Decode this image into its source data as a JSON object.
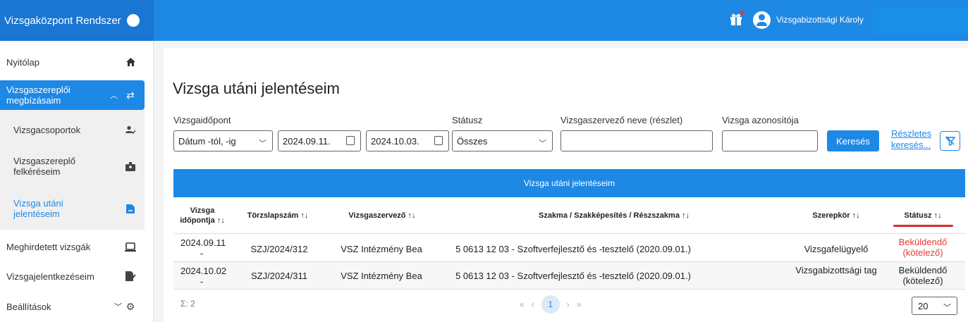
{
  "app": {
    "title": "Vizsgaközpont Rendszer",
    "user": "Vizsgabizottsági Károly"
  },
  "sidebar": {
    "items": [
      {
        "label": "Nyitólap",
        "icon": "home-icon"
      },
      {
        "label": "Vizsgaszereplői megbízásaim",
        "icon": "assignment-icon"
      },
      {
        "label": "Vizsgacsoportok",
        "icon": "group-icon"
      },
      {
        "label": "Vizsgaszereplő felkéréseim",
        "icon": "badge-icon"
      },
      {
        "label": "Vizsga utáni jelentéseim",
        "icon": "document-icon"
      },
      {
        "label": "Meghirdetett vizsgák",
        "icon": "laptop-icon"
      },
      {
        "label": "Vizsgajelentkezéseim",
        "icon": "edit-doc-icon"
      },
      {
        "label": "Beállítások",
        "icon": "gear-icon"
      }
    ]
  },
  "page": {
    "title": "Vizsga utáni jelentéseim"
  },
  "filters": {
    "date_label": "Vizsgaidőpont",
    "date_mode": "Dátum -tól, -ig",
    "date_from": "2024.09.11.",
    "date_to": "2024.10.03.",
    "status_label": "Státusz",
    "status_value": "Összes",
    "organizer_label": "Vizsgaszervező neve (részlet)",
    "organizer_value": "",
    "exam_id_label": "Vizsga azonosítója",
    "exam_id_value": "",
    "search_button": "Keresés",
    "advanced_link": "Részletes keresés..."
  },
  "table": {
    "title": "Vizsga utáni jelentéseim",
    "headers": {
      "date": "Vizsga időpontja",
      "reg": "Törzslapszám",
      "org": "Vizsgaszervező",
      "prof": "Szakma / Szakképesítés / Részszakma",
      "role": "Szerepkör",
      "status": "Státusz"
    },
    "rows": [
      {
        "date": "2024.09.11",
        "dash": "-",
        "reg": "SZJ/2024/312",
        "org": "VSZ Intézmény Bea",
        "prof": "5 0613 12 03 - Szoftverfejlesztő és -tesztelő (2020.09.01.)",
        "role": "Vizsgafelügyelő",
        "status": "Beküldendő (kötelező)",
        "status_color": "#e53935"
      },
      {
        "date": "2024.10.02",
        "dash": "-",
        "reg": "SZJ/2024/311",
        "org": "VSZ Intézmény Bea",
        "prof": "5 0613 12 03 - Szoftverfejlesztő és -tesztelő (2020.09.01.)",
        "role": "Vizsgabizottsági tag",
        "status": "Beküldendő (kötelező)",
        "status_color": "#222222"
      }
    ],
    "sum": "Σ: 2",
    "page": "1",
    "page_size": "20"
  }
}
